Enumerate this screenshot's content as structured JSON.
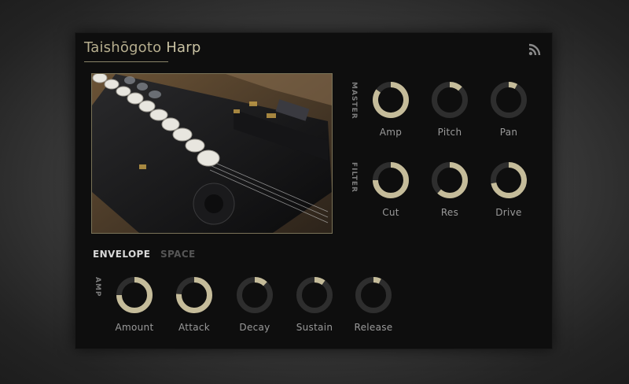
{
  "title_main": "Taishōgoto",
  "title_sub": "Harp",
  "colors": {
    "accent": "#c9c2a3",
    "knob_arc": "#c5bc9a",
    "knob_track": "#2e2e2e",
    "tab_active": "#d8d8d8",
    "tab_inactive": "#555555"
  },
  "icons": {
    "top_right": "rss-icon"
  },
  "image": {
    "alt": "Taishōgoto instrument photo"
  },
  "sections": {
    "master": {
      "label": "MASTER",
      "knobs": [
        {
          "label": "Amp",
          "value": 0.85
        },
        {
          "label": "Pitch",
          "value": 0.12
        },
        {
          "label": "Pan",
          "value": 0.08
        }
      ]
    },
    "filter": {
      "label": "FILTER",
      "knobs": [
        {
          "label": "Cut",
          "value": 0.75
        },
        {
          "label": "Res",
          "value": 0.62
        },
        {
          "label": "Drive",
          "value": 0.72
        }
      ]
    }
  },
  "tabs": [
    {
      "label": "ENVELOPE",
      "active": true
    },
    {
      "label": "SPACE",
      "active": false
    }
  ],
  "envelope": {
    "label": "AMP",
    "knobs": [
      {
        "label": "Amount",
        "value": 0.75
      },
      {
        "label": "Attack",
        "value": 0.76
      },
      {
        "label": "Decay",
        "value": 0.12
      },
      {
        "label": "Sustain",
        "value": 0.1
      },
      {
        "label": "Release",
        "value": 0.07
      }
    ]
  }
}
